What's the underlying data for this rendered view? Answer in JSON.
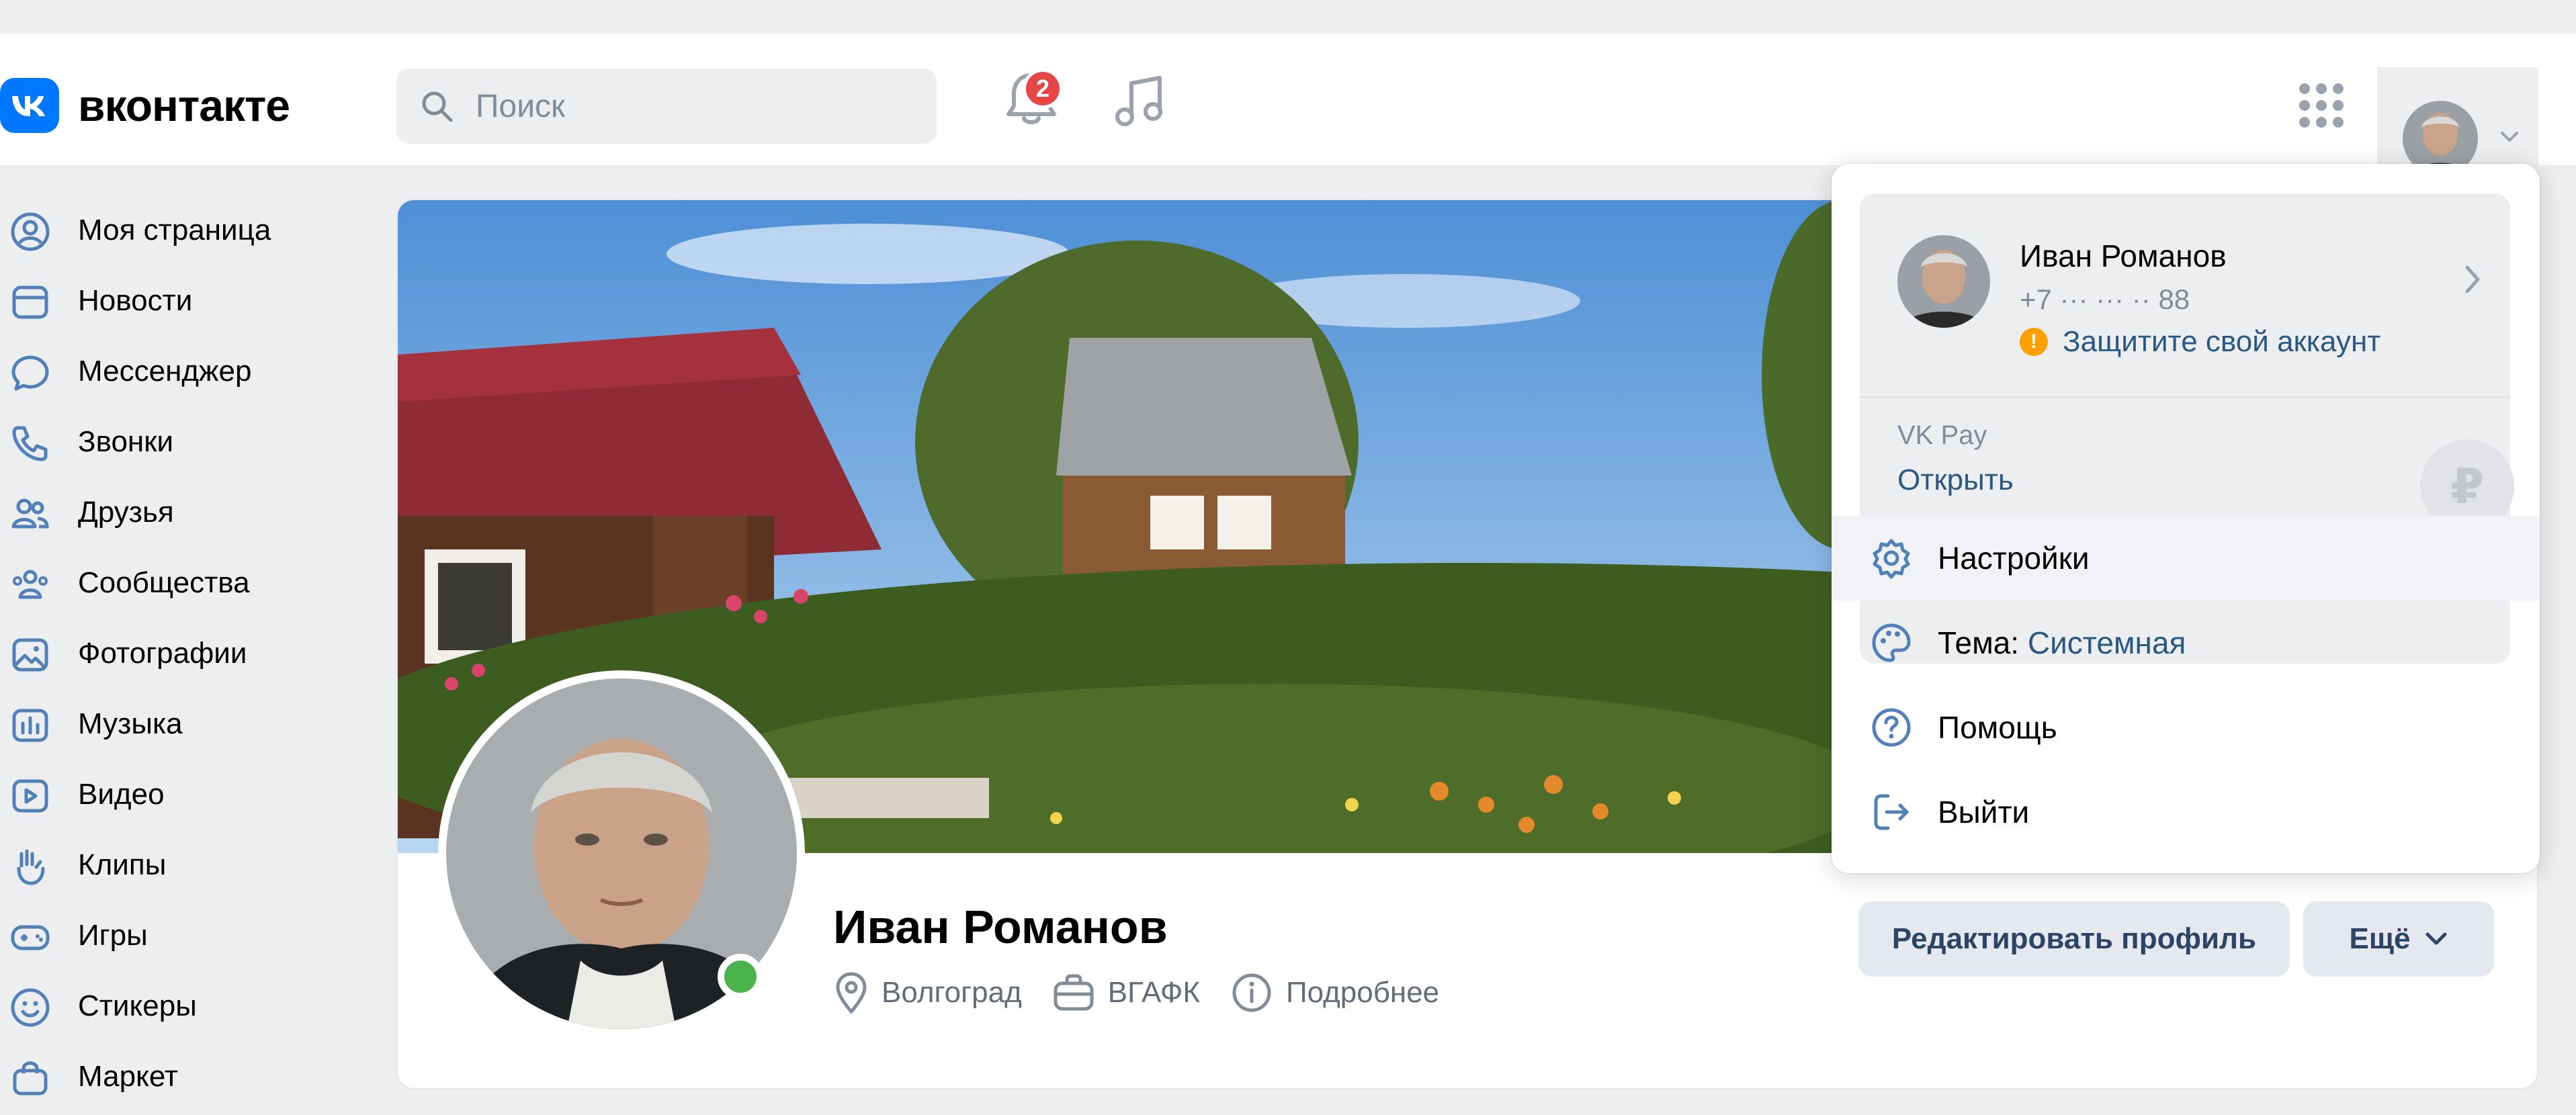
{
  "brand": {
    "name": "вконтакте",
    "color": "#0077ff"
  },
  "search": {
    "placeholder": "Поиск"
  },
  "notifications": {
    "count": "2"
  },
  "sidebar": {
    "items": [
      {
        "label": "Моя страница",
        "icon": "user-circle-icon"
      },
      {
        "label": "Новости",
        "icon": "newsfeed-icon"
      },
      {
        "label": "Мессенджер",
        "icon": "message-icon"
      },
      {
        "label": "Звонки",
        "icon": "phone-icon"
      },
      {
        "label": "Друзья",
        "icon": "friends-icon"
      },
      {
        "label": "Сообщества",
        "icon": "communities-icon"
      },
      {
        "label": "Фотографии",
        "icon": "photo-icon"
      },
      {
        "label": "Музыка",
        "icon": "music-chart-icon"
      },
      {
        "label": "Видео",
        "icon": "video-icon"
      },
      {
        "label": "Клипы",
        "icon": "clips-icon"
      },
      {
        "label": "Игры",
        "icon": "gamepad-icon"
      },
      {
        "label": "Стикеры",
        "icon": "smile-icon"
      },
      {
        "label": "Маркет",
        "icon": "bag-icon"
      }
    ]
  },
  "profile": {
    "name": "Иван Романов",
    "city": "Волгоград",
    "education": "ВГАФК",
    "more_info": "Подробнее",
    "edit_button": "Редактировать профиль",
    "more_button": "Ещё",
    "online": true
  },
  "dropdown": {
    "account": {
      "name": "Иван Романов",
      "phone": "+7 ··· ··· ·· 88",
      "warning": "Защитите свой аккаунт",
      "warning_mark": "!"
    },
    "pay": {
      "title": "VK Pay",
      "action": "Открыть",
      "currency_symbol": "₽"
    },
    "menu": {
      "settings": "Настройки",
      "theme_label": "Тема:",
      "theme_value": "Системная",
      "help": "Помощь",
      "logout": "Выйти"
    }
  },
  "colors": {
    "link": "#2a5885",
    "online": "#4bb34b",
    "badge": "#e64646",
    "warning": "#ffa000"
  }
}
